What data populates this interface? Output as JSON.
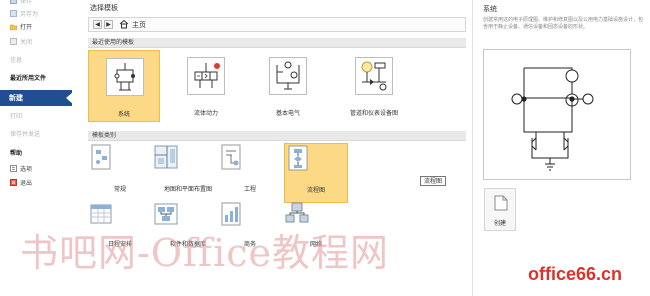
{
  "nav": {
    "items": [
      {
        "label": "保存",
        "state": "dim",
        "icon": "save-icon"
      },
      {
        "label": "另存为",
        "state": "dim",
        "icon": "save-as-icon"
      },
      {
        "label": "打开",
        "state": "normal",
        "icon": "open-folder-icon"
      },
      {
        "label": "关闭",
        "state": "dim",
        "icon": "close-doc-icon"
      },
      {
        "label": "信息",
        "state": "dim",
        "icon": ""
      },
      {
        "label": "最近所用文件",
        "state": "bold",
        "icon": ""
      },
      {
        "label": "新建",
        "state": "active",
        "icon": ""
      },
      {
        "label": "打印",
        "state": "dim",
        "icon": ""
      },
      {
        "label": "保存并发送",
        "state": "dim",
        "icon": ""
      },
      {
        "label": "帮助",
        "state": "bold",
        "icon": ""
      },
      {
        "label": "选项",
        "state": "normal",
        "icon": "options-icon"
      },
      {
        "label": "退出",
        "state": "normal",
        "icon": "exit-icon"
      }
    ],
    "active_color": "#1f4e93"
  },
  "center": {
    "title": "选择模板",
    "back_icon": "arrow-left-icon",
    "forward_icon": "arrow-right-icon",
    "home_icon": "home-icon",
    "home_label": "主页",
    "recent_section": "最近使用的模板",
    "recent_templates": [
      {
        "label": "系统",
        "icon": "system-template-icon",
        "selected": true
      },
      {
        "label": "流体动力",
        "icon": "fluid-power-template-icon",
        "selected": false
      },
      {
        "label": "基本电气",
        "icon": "basic-electrical-template-icon",
        "selected": false
      },
      {
        "label": "管道和仪表设备图",
        "icon": "piping-instrumentation-template-icon",
        "selected": false
      }
    ],
    "category_section": "模板类别",
    "categories": [
      {
        "label": "常规",
        "icon": "general-category-icon",
        "selected": false
      },
      {
        "label": "地图和平面布置图",
        "icon": "maps-floor-plans-category-icon",
        "selected": false
      },
      {
        "label": "工程",
        "icon": "engineering-category-icon",
        "selected": false
      },
      {
        "label": "流程图",
        "icon": "flowchart-category-icon",
        "selected": true
      },
      {
        "label": "日程安排",
        "icon": "schedule-category-icon",
        "selected": false
      },
      {
        "label": "软件和数据库",
        "icon": "software-database-category-icon",
        "selected": false
      },
      {
        "label": "商务",
        "icon": "business-category-icon",
        "selected": false
      },
      {
        "label": "网络",
        "icon": "network-category-icon",
        "selected": false
      }
    ],
    "tooltip": "流程图",
    "selection_color": "#fcd984"
  },
  "preview": {
    "title": "系统",
    "description": "创建常用这的电子原理图、维护和修复图以及公用电力基础设施设计，包含用于静止设备、通信设备和固态设备的形状。",
    "create_label": "创建",
    "create_icon": "create-icon"
  },
  "watermarks": {
    "chinese": "书吧网-Office教程网",
    "site": "office66.cn",
    "site_color": "#d9332b"
  }
}
